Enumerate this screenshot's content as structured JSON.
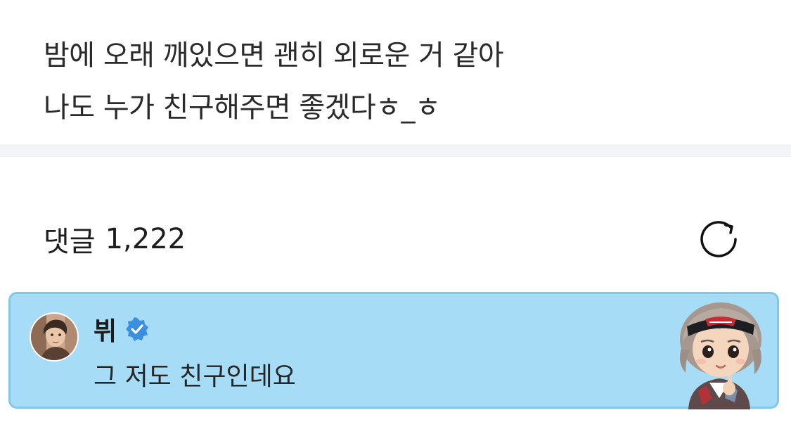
{
  "post": {
    "lines": [
      "밤에 오래 깨있으면 괜히 외로운 거 같아",
      "나도 누가 친구해주면 좋겠다ㅎ_ㅎ"
    ]
  },
  "comments": {
    "label": "댓글",
    "count": "1,222",
    "refresh_icon": "refresh-icon"
  },
  "highlighted_comment": {
    "author": "뷔",
    "verified": true,
    "text": "그 저도 친구인데요",
    "avatar_icon": "avatar-photo",
    "sticker_icon": "character-sticker"
  },
  "colors": {
    "card_background": "#a6dcf6",
    "card_border": "#7fc8ec",
    "verified_badge": "#3b8fe0",
    "divider": "#f3f4f8"
  }
}
